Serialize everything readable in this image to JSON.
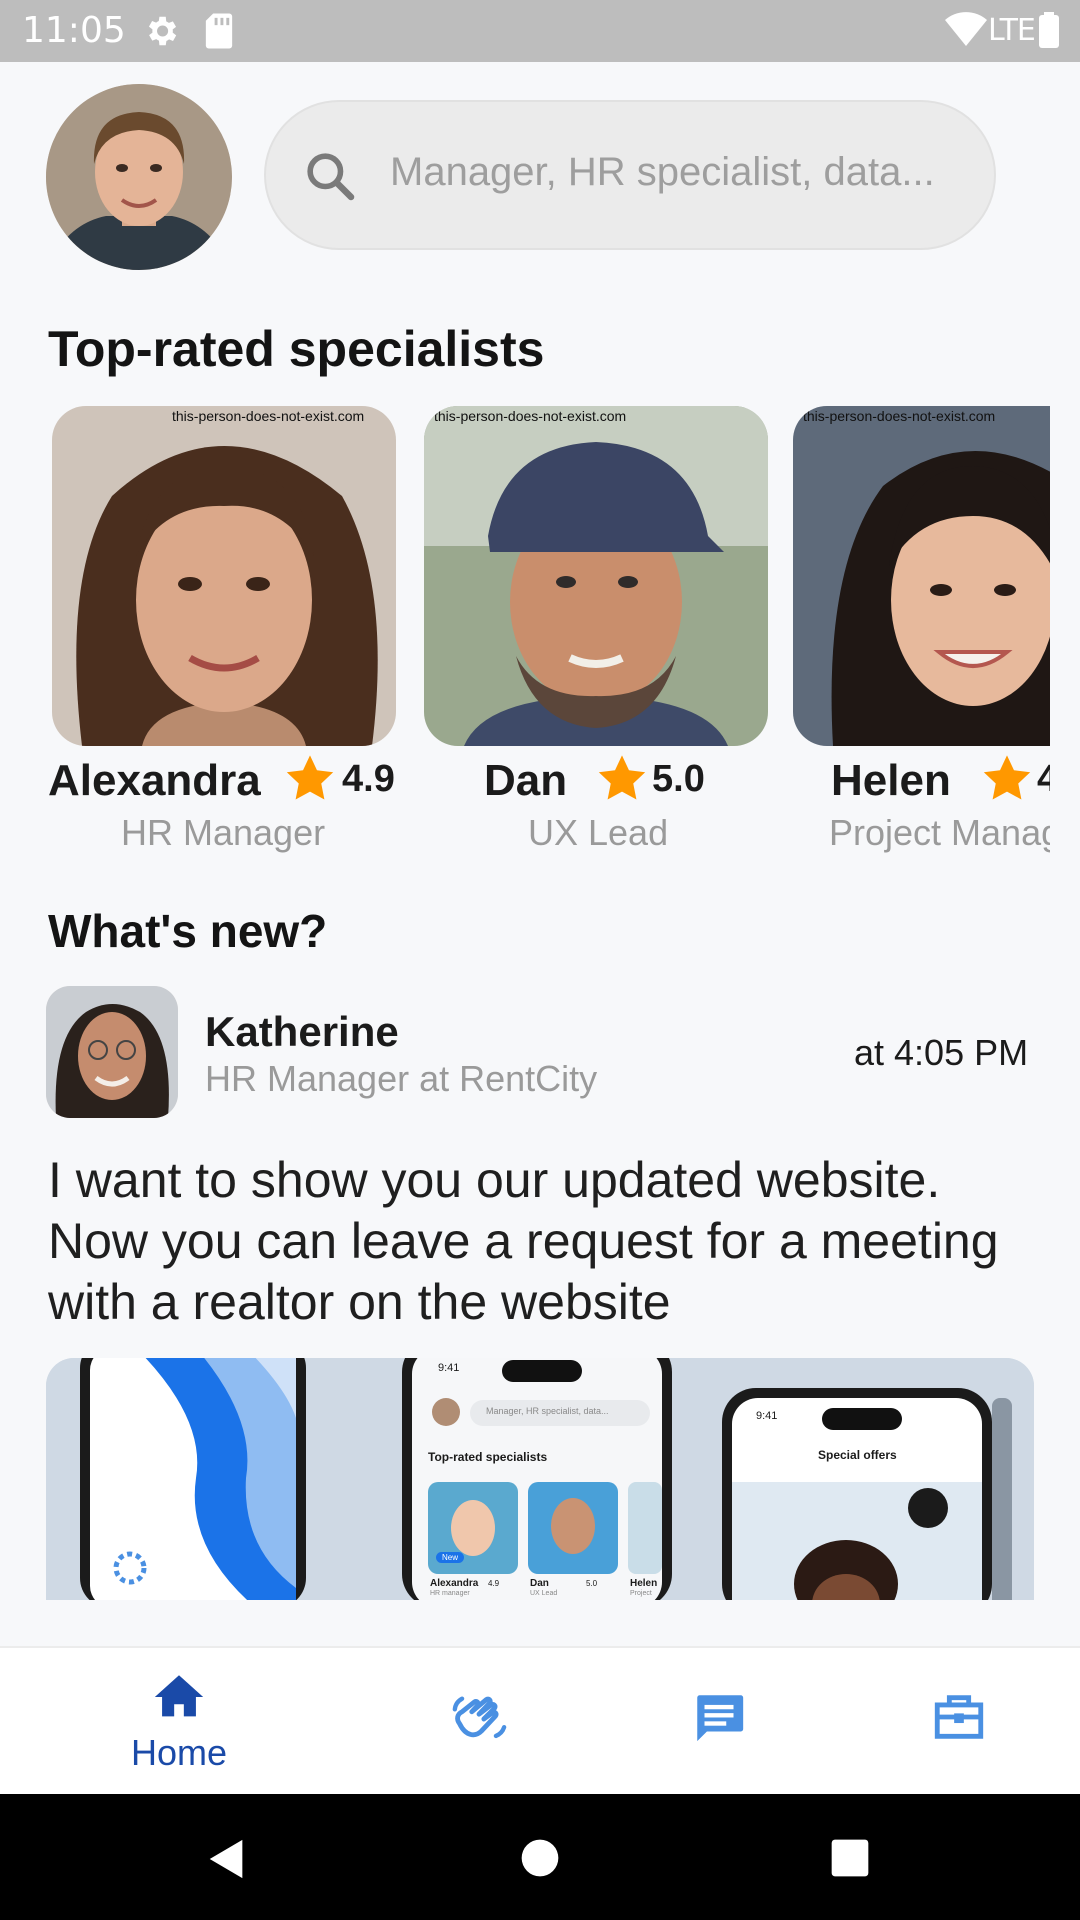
{
  "status_bar": {
    "time": "11:05",
    "network": "LTE"
  },
  "header": {
    "search_placeholder": "Manager, HR specialist, data..."
  },
  "sections": {
    "top_rated": "Top-rated specialists",
    "whats_new": "What's new?"
  },
  "specialists": [
    {
      "name": "Alexandra",
      "rating": "4.9",
      "role": "HR Manager"
    },
    {
      "name": "Dan",
      "rating": "5.0",
      "role": "UX Lead"
    },
    {
      "name": "Helen",
      "rating": "4",
      "role": "Project Manager"
    }
  ],
  "photo_watermark": "this-person-does-not-exist.com",
  "news": {
    "author": "Katherine",
    "subtitle": "HR Manager at RentCity",
    "time": "at 4:05 PM",
    "text": "I want to show you our updated website. Now you can leave a request for a meeting with a realtor on the website",
    "banner": {
      "time": "9:41",
      "search": "Manager, HR specialist, data...",
      "section": "Top-rated specialists",
      "badge": "New",
      "names": [
        "Alexandra",
        "Dan",
        "Helen"
      ],
      "roles": [
        "HR manager",
        "UX Lead",
        "Project"
      ],
      "ratings": [
        "4.9",
        "5.0"
      ],
      "offers_title": "Special offers"
    }
  },
  "bottom_nav": [
    {
      "label": "Home",
      "icon": "home-icon",
      "active": true
    },
    {
      "label": "",
      "icon": "handshake-icon",
      "active": false
    },
    {
      "label": "",
      "icon": "chat-icon",
      "active": false
    },
    {
      "label": "",
      "icon": "briefcase-icon",
      "active": false
    }
  ],
  "colors": {
    "active": "#1a4aa8",
    "inactive": "#4a90e2",
    "star": "#ff9800"
  }
}
